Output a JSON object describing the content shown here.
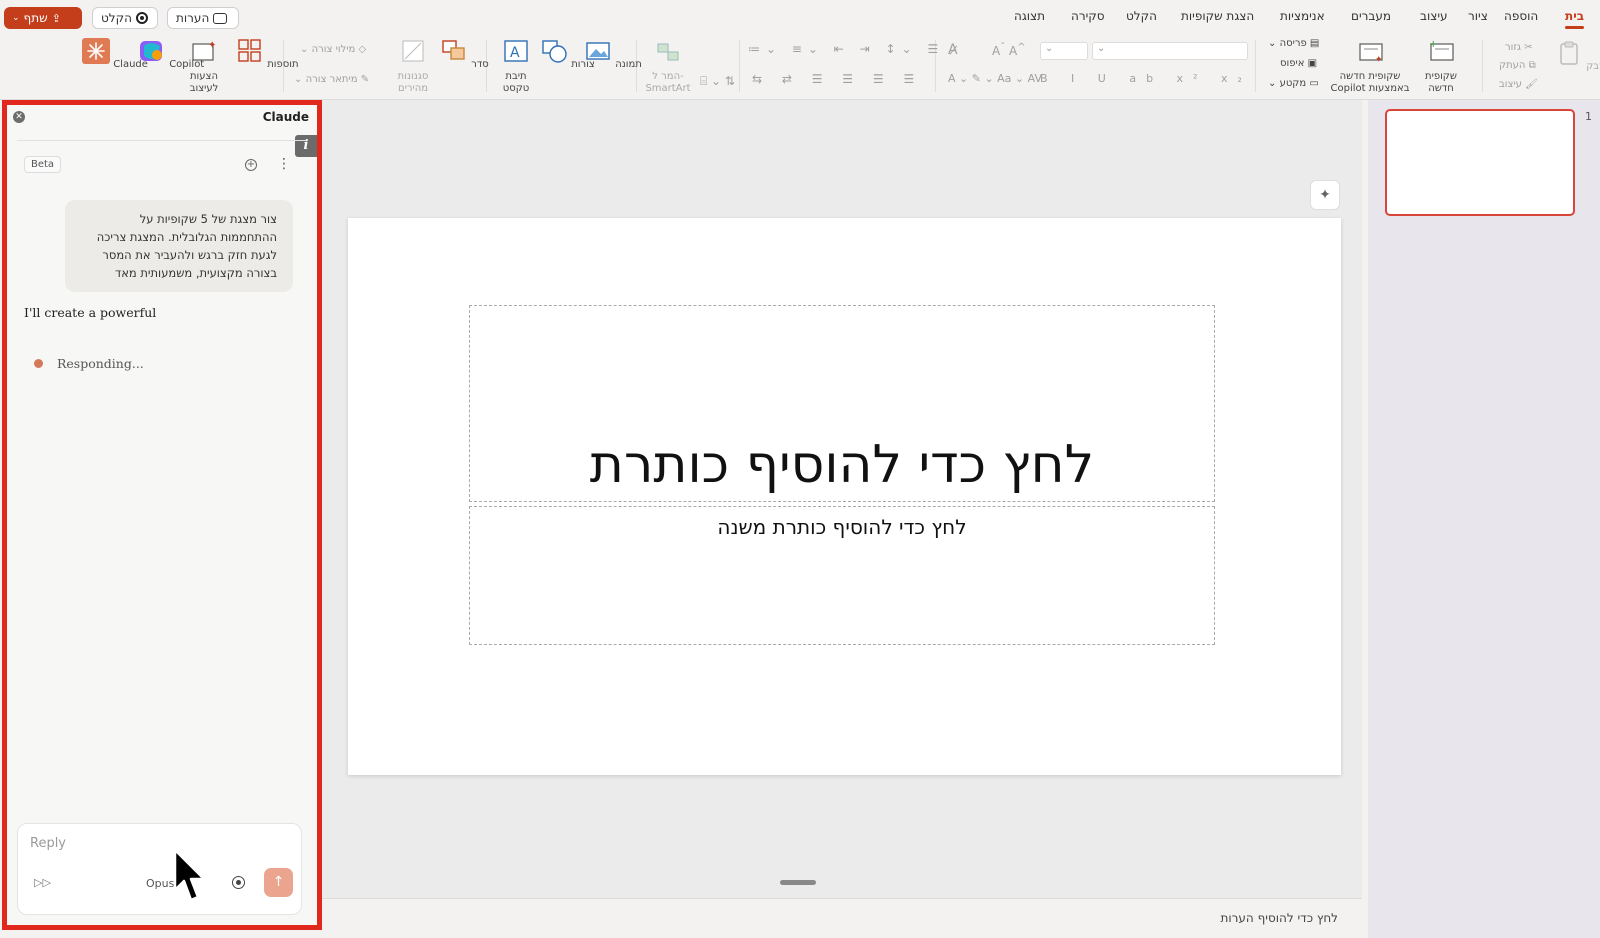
{
  "tabs": [
    {
      "label": "בית",
      "active": true
    },
    {
      "label": "הוספה"
    },
    {
      "label": "ציור"
    },
    {
      "label": "עיצוב"
    },
    {
      "label": "מעברים"
    },
    {
      "label": "אנימציות"
    },
    {
      "label": "הצגת שקופיות"
    },
    {
      "label": "הקלט"
    },
    {
      "label": "סקירה"
    },
    {
      "label": "תצוגה"
    }
  ],
  "top_buttons": {
    "share": "שתף",
    "record": "הקלט",
    "comments": "הערות"
  },
  "ribbon": {
    "paste": "הדבק",
    "cut": "גזור",
    "copy": "העתק",
    "format_painter": "עיצוב",
    "new_slide": [
      "שקופית",
      "חדשה"
    ],
    "copilot_slide": [
      "שקופית חדשה",
      "Copilot באמצעות"
    ],
    "layout": "פריסה",
    "reset": "איפוס",
    "section": "מקטע",
    "smartart": [
      "המר ל-",
      "SmartArt"
    ],
    "picture": "תמונה",
    "shapes": "צורות",
    "textbox": [
      "תיבת",
      "טקסט"
    ],
    "arrange": "סדר",
    "quick_styles": [
      "סגנונות",
      "מהירים"
    ],
    "shape_fill": "מילוי צורה",
    "shape_outline": "מיתאר צורה",
    "addins": "תוספות",
    "design_ideas": [
      "הצעות",
      "לעיצוב"
    ],
    "copilot": "Copilot",
    "claude": "Claude",
    "accent_color": "#c43e1c"
  },
  "claude_pane": {
    "title": "Claude",
    "badge": "Beta",
    "user_message": [
      "צור מצגת של 5 שקופיות על",
      "ההתחממות הגלובלית. המצגת צריכה",
      "לגעת חזק ברגש ולהעביר את המסר",
      "בצורה מקצועית, משמעותית מאד"
    ],
    "assistant_message": "I'll create a powerful",
    "status": "Responding...",
    "input_placeholder": "Reply",
    "model": "Opus",
    "highlight_color": "#e0281c"
  },
  "slide": {
    "title_placeholder": "לחץ כדי להוסיף כותרת",
    "subtitle_placeholder": "לחץ כדי להוסיף כותרת משנה"
  },
  "notes_placeholder": "לחץ כדי להוסיף הערות",
  "thumbnails": [
    {
      "number": "1"
    }
  ]
}
